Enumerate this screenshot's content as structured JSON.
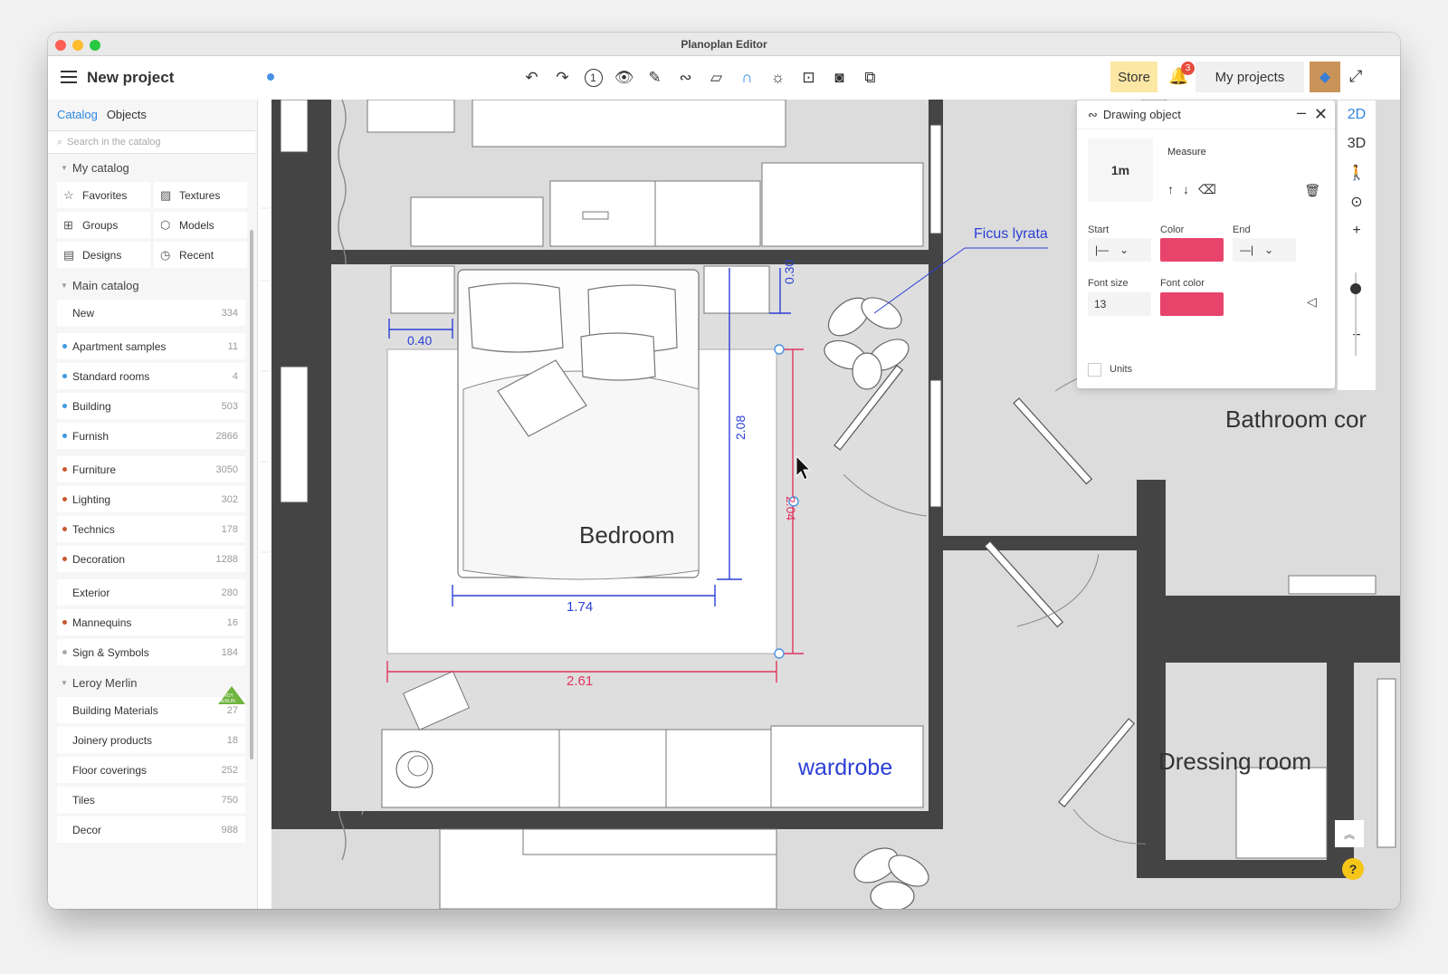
{
  "window": {
    "title": "Planoplan Editor"
  },
  "header": {
    "project_title": "New project",
    "store_label": "Store",
    "notification_count": "3",
    "my_projects_label": "My projects",
    "tools": [
      "undo",
      "redo",
      "step",
      "view",
      "paint",
      "draw",
      "measure",
      "snap",
      "light",
      "plan",
      "camera",
      "render"
    ]
  },
  "sidebar": {
    "tabs": [
      "Catalog",
      "Objects"
    ],
    "search_placeholder": "Search in the catalog",
    "my_catalog": {
      "title": "My catalog",
      "items": [
        {
          "label": "Favorites",
          "icon": "star-icon"
        },
        {
          "label": "Textures",
          "icon": "texture-icon"
        },
        {
          "label": "Groups",
          "icon": "grid-icon"
        },
        {
          "label": "Models",
          "icon": "cube-icon"
        },
        {
          "label": "Designs",
          "icon": "design-icon"
        },
        {
          "label": "Recent",
          "icon": "clock-icon"
        }
      ]
    },
    "main_catalog": {
      "title": "Main catalog",
      "items": [
        {
          "label": "New",
          "count": "334",
          "dot": ""
        },
        {
          "label": "Apartment samples",
          "count": "11",
          "dot": "#3b9ae1"
        },
        {
          "label": "Standard rooms",
          "count": "4",
          "dot": "#3b9ae1"
        },
        {
          "label": "Building",
          "count": "503",
          "dot": "#3b9ae1"
        },
        {
          "label": "Furnish",
          "count": "2866",
          "dot": "#3b9ae1"
        },
        {
          "label": "Furniture",
          "count": "3050",
          "dot": "#c65a2e"
        },
        {
          "label": "Lighting",
          "count": "302",
          "dot": "#c65a2e"
        },
        {
          "label": "Technics",
          "count": "178",
          "dot": "#c65a2e"
        },
        {
          "label": "Decoration",
          "count": "1288",
          "dot": "#c65a2e"
        },
        {
          "label": "Exterior",
          "count": "280",
          "dot": ""
        },
        {
          "label": "Mannequins",
          "count": "16",
          "dot": "#c65a2e"
        },
        {
          "label": "Sign & Symbols",
          "count": "184",
          "dot": "#aaaaaa"
        }
      ]
    },
    "leroy": {
      "title": "Leroy Merlin",
      "logo_text": "LEROY MERLIN",
      "items": [
        {
          "label": "Building Materials",
          "count": "27"
        },
        {
          "label": "Joinery products",
          "count": "18"
        },
        {
          "label": "Floor coverings",
          "count": "252"
        },
        {
          "label": "Tiles",
          "count": "750"
        },
        {
          "label": "Decor",
          "count": "988"
        }
      ]
    }
  },
  "plan": {
    "rooms": {
      "bedroom": "Bedroom",
      "bathroom": "Bathroom cor",
      "dressing": "Dressing room"
    },
    "wardrobe_label": "wardrobe",
    "plant_label": "Ficus lyrata",
    "dimensions": {
      "d040": "0.40",
      "d030": "0.30",
      "d208": "2.08",
      "d204": "2.04",
      "d174": "1.74",
      "d261": "2.61"
    }
  },
  "drawing_panel": {
    "title": "Drawing object",
    "measure_label": "Measure",
    "preview_text": "1m",
    "start_label": "Start",
    "color_label": "Color",
    "end_label": "End",
    "font_size_label": "Font size",
    "font_size_value": "13",
    "font_color_label": "Font color",
    "units_label": "Units",
    "color": "#e8436b",
    "font_color": "#e8436b"
  },
  "view_controls": {
    "mode_2d": "2D",
    "mode_3d": "3D",
    "help": "?"
  },
  "colors": {
    "accent": "#2d86e0",
    "dimension_blue": "#2b3fd6",
    "dimension_red": "#e0355e",
    "wall": "#444444"
  }
}
